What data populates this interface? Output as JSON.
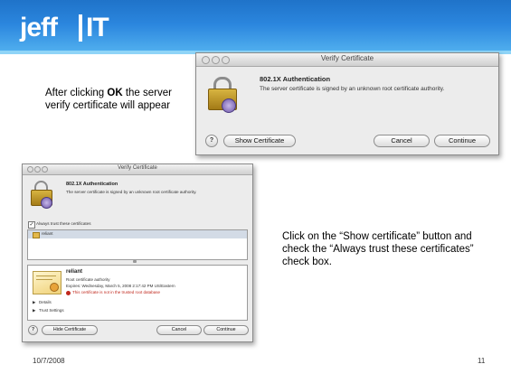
{
  "header": {
    "logo_left": "jeff",
    "logo_right": "IT"
  },
  "intro_text": {
    "prefix": "After clicking ",
    "ok": "OK",
    "suffix": " the server verify certificate will appear"
  },
  "instruction_text": "Click on the “Show certificate” button and check the “Always trust these certificates” check box.",
  "footer": {
    "date": "10/7/2008",
    "page": "11"
  },
  "dialog_top": {
    "title": "Verify Certificate",
    "heading": "802.1X Authentication",
    "message": "The server certificate is signed by an unknown root certificate authority.",
    "help": "?",
    "show_button": "Show Certificate",
    "cancel_button": "Cancel",
    "continue_button": "Continue"
  },
  "dialog_bottom": {
    "title": "Verify Certificate",
    "heading": "802.1X Authentication",
    "message": "The server certificate is signed by an unknown root certificate authority.",
    "always_trust": "Always trust these certificates",
    "cert_item": "reliant",
    "cert_name": "reliant",
    "cert_type": "Root certificate authority",
    "cert_expires": "Expires: Wednesday, March 5, 2008 2:17:42 PM US/Eastern",
    "cert_warning": "This certificate is not in the trusted root database",
    "details": "Details",
    "trust_settings": "Trust Settings",
    "help": "?",
    "hide_button": "Hide Certificate",
    "cancel_button": "Cancel",
    "continue_button": "Continue"
  },
  "colors": {
    "header_blue": "#1f73c9",
    "warning_red": "#c0281d"
  }
}
